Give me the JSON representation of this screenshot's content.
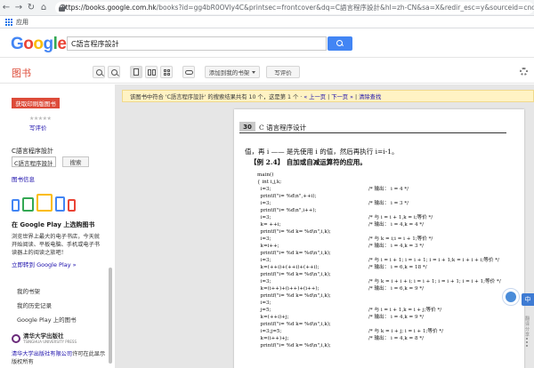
{
  "browser": {
    "url_secure_part": "https://books.google.com.hk",
    "url_rest": "/books?id=gg4bR0OVly4C&printsec=frontcover&dq=C語言程序設計&hl=zh-CN&sa=X&redir_esc=y&sourceid=cndr#v=onepa",
    "bookmark_apps": "应用"
  },
  "header": {
    "logo_letters": [
      "G",
      "o",
      "o",
      "g",
      "l",
      "e"
    ],
    "search_value": "C語言程序設計"
  },
  "toolbar": {
    "section_title": "图书",
    "add_to_library": "添加到我的书架",
    "write_review": "写评价"
  },
  "sidebar": {
    "get_print_button": "获取印刷版图书",
    "stars": "★★★★★",
    "review_link": "写评价",
    "book_title": "C語言程序設計",
    "search_in_book_value": "C語言程序設計",
    "search_button": "搜索",
    "book_info": "图书信息",
    "play_title": "在 Google Play 上选购图书",
    "play_desc": "浏览世界上最大的电子书店，今天就开始阅读、平板电脑、手机或电子书读器上的阅读之旅吧！",
    "play_link": "立即转到 Google Play »",
    "my_library": "我的书架",
    "my_history": "我的历史记录",
    "google_play_books": "Google Play 上的图书",
    "publisher_name": "清华大学出版社",
    "publisher_sub": "TSINGHUA UNIVERSITY PRESS",
    "copyright_link": "清华大学出版社有限公司",
    "copyright_text": "许可在此显示",
    "copyright_text2": "版权所有"
  },
  "viewer": {
    "notice_pre": "该图书中符合 'C語言程序設計' 的搜索结果共有 10 个，这是第 1 个 · ",
    "notice_prev": "« 上一页",
    "notice_next": "下一页 »",
    "notice_clear": "清除查找",
    "page_number": "30",
    "page_header": "C 语言程序设计",
    "line1": "值，再 i —— 是先使用 i 的值，然后再执行 i=i-1。",
    "line2": "【例 2.4】  自加或自减运算符的应用。",
    "code_left": "main()\n{ int i,j,k;\n  i=3;\n  printf(\"i= %d\\n\",++i);\n  i=3;\n  printf(\"i= %d\\n\",i++);\n  i=3;\n  k= ++i;\n  printf(\"i= %d k= %d\\n\",i,k);\n  i=3;\n  k=i++;\n  printf(\"i= %d k= %d\\n\",i,k);\n  i=3;\n  k=(++i)+(++i)+(++i);\n  printf(\"i= %d k= %d\\n\",i,k);\n  i=3;\n  k=(i++)+(i++)+(i++);\n  printf(\"i= %d k= %d\\n\",i,k);\n  i=3;\n  j=5;\n  k=(++i)+j;\n  printf(\"i= %d k= %d\\n\",i,k);\n  i=3;j=5;\n  k=(i++)+j;\n  printf(\"i= %d k= %d\\n\",i,k);",
    "code_right": "/* 输出： i = 4 */\n\n/* 输出： i = 3 */\n\n/* 与 i = i + 1,k = i;等价 */\n/* 输出： i = 4,k = 4 */\n\n/* 与 k = i;i = i + 1;等价 */\n/* 输出： i = 4,k = 3 */\n\n/* 与 i = i + 1; i = i + 1; i = i + 1;k = i + i + i;等价 */\n/* 输出： i = 6,k = 18 */\n\n/* 与 k = i + i + i; i = i + 1; i = i + 1; i = i + 1;等价 */\n/* 输出： i = 6,k = 9 */\n\n\n/* 与 i = i + 1,k = i + j;等价 */\n/* 输出： i = 4,k = 9 */\n\n/* 与 k = i + j; i = i + 1;等价 */\n/* 输出： i = 4,k = 8 */"
  },
  "side_widgets": {
    "lang_tab": "中",
    "vertical_text": "翻译分享"
  },
  "colors": {
    "accent_red": "#dd4b39",
    "google_blue": "#4285f4",
    "notice_bg": "#fff3c4",
    "link": "#1a0dab"
  }
}
